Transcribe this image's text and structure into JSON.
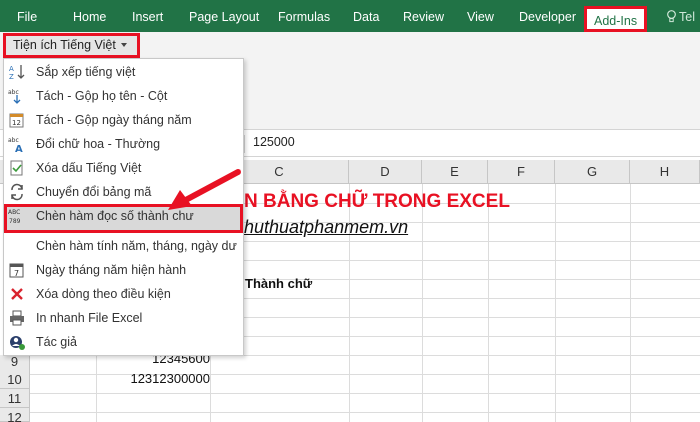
{
  "ribbon": {
    "tabs": [
      {
        "label": "File"
      },
      {
        "label": "Home"
      },
      {
        "label": "Insert"
      },
      {
        "label": "Page Layout"
      },
      {
        "label": "Formulas"
      },
      {
        "label": "Data"
      },
      {
        "label": "Review"
      },
      {
        "label": "View"
      },
      {
        "label": "Developer"
      },
      {
        "label": "Add-Ins"
      },
      {
        "label": "Tel"
      }
    ],
    "active_tab": "Add-Ins",
    "menu_button_label": "Tiện ích Tiếng Việt"
  },
  "dropdown": {
    "items": [
      {
        "label": "Sắp xếp tiếng việt",
        "icon": "sort-az-icon"
      },
      {
        "label": "Tách - Gộp họ tên - Cột",
        "icon": "split-merge-icon"
      },
      {
        "label": "Tách - Gộp ngày tháng năm",
        "icon": "calendar-split-icon"
      },
      {
        "label": "Đổi chữ hoa - Thường",
        "icon": "change-case-icon"
      },
      {
        "label": "Xóa dấu Tiếng Việt",
        "icon": "remove-accent-icon"
      },
      {
        "label": "Chuyển đổi bảng mã",
        "icon": "convert-encoding-icon"
      },
      {
        "label": "Chèn hàm đọc số thành chư",
        "icon": "number-to-text-icon"
      },
      {
        "label": "Chèn hàm tính năm, tháng, ngày dư",
        "icon": "date-calc-icon"
      },
      {
        "label": "Ngày tháng năm hiện hành",
        "icon": "current-date-icon"
      },
      {
        "label": "Xóa dòng theo điều kiện",
        "icon": "delete-row-icon"
      },
      {
        "label": "In nhanh File Excel",
        "icon": "printer-icon"
      },
      {
        "label": "Tác giả",
        "icon": "author-icon"
      }
    ],
    "highlighted_index": 6
  },
  "formula_bar": {
    "value": "125000"
  },
  "grid": {
    "columns": [
      "C",
      "D",
      "E",
      "F",
      "G",
      "H"
    ],
    "rows": [
      "9",
      "10",
      "11",
      "12"
    ],
    "title_text": "N BẰNG CHỮ TRONG EXCEL",
    "link_text": "huthuatphanmem.vn",
    "header_text": "Thành chữ",
    "values": [
      {
        "row": "9",
        "text": "12345600"
      },
      {
        "row": "10",
        "text": "12312300000"
      }
    ]
  },
  "colors": {
    "ribbon_green": "#217346",
    "highlight_red": "#e81123"
  }
}
